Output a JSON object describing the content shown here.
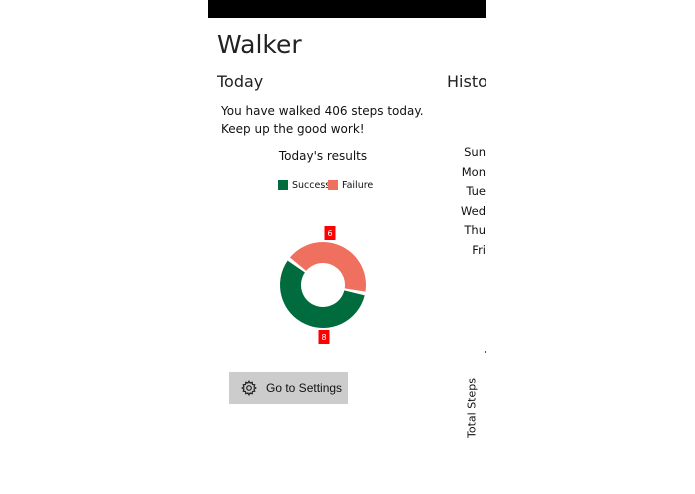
{
  "app": {
    "title": "Walker",
    "sections": {
      "today": "Today",
      "history": "Histor"
    }
  },
  "today": {
    "message": "You have walked 406 steps today. Keep up the good work!",
    "results_title": "Today's results",
    "settings_button_label": "Go to Settings"
  },
  "history": {
    "days": [
      "Sun",
      "Mon",
      "Tue",
      "Wed",
      "Thu",
      "Fri"
    ],
    "axis_label": "Total Steps"
  },
  "colors": {
    "success": "#006b3c",
    "failure": "#f07060",
    "value_label_bg": "#ff0000"
  },
  "icons": {
    "settings": "gear-icon"
  },
  "chart_data": {
    "type": "pie",
    "style": "donut",
    "title": "Today's results",
    "legend_position": "top",
    "slices": [
      {
        "name": "Success",
        "value": 8
      },
      {
        "name": "Failure",
        "value": 6
      }
    ]
  }
}
